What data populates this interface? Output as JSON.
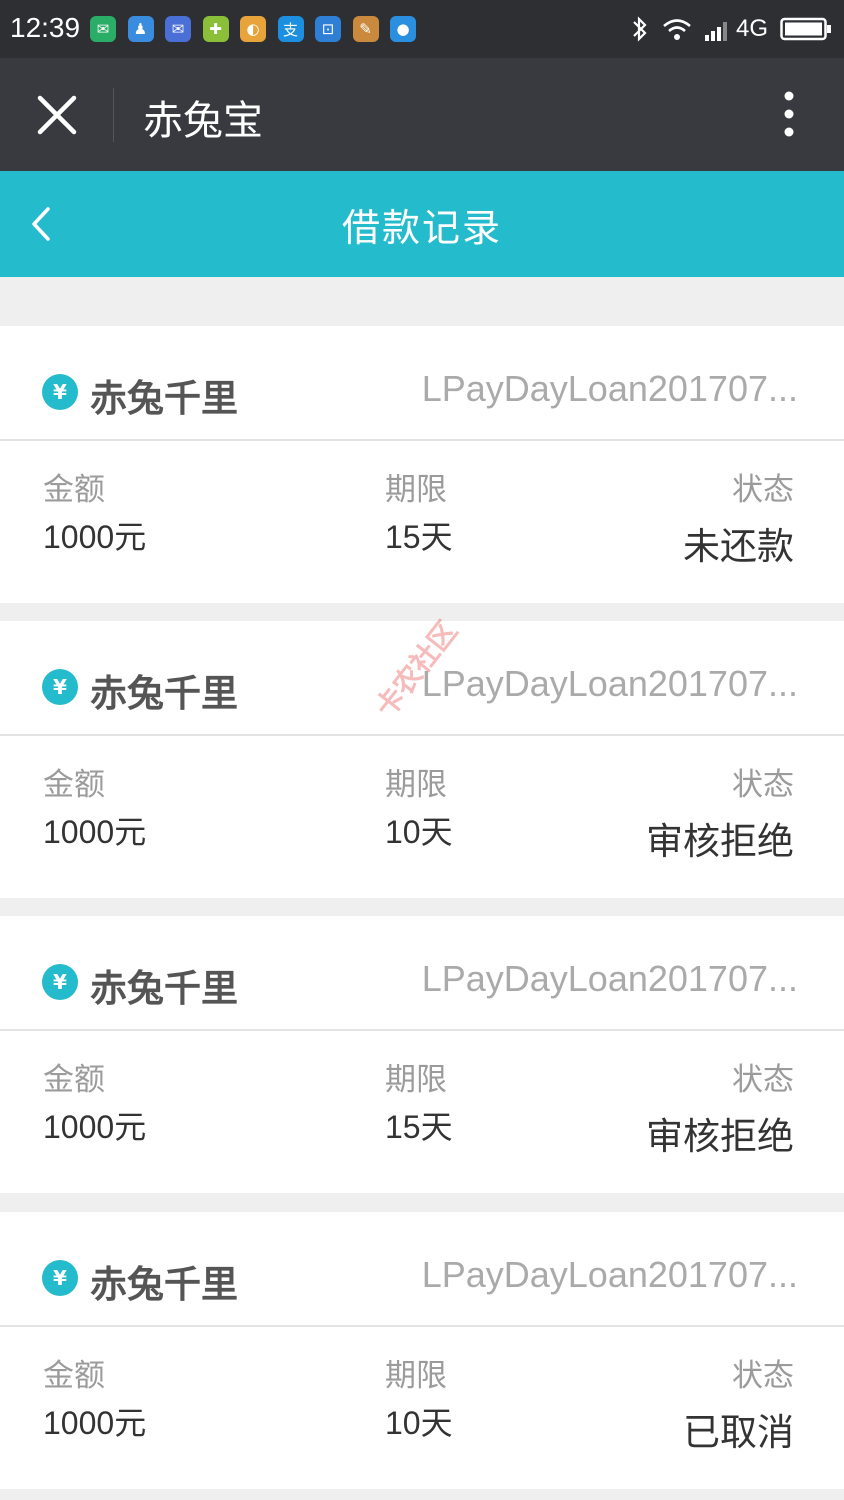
{
  "status_bar": {
    "time": "12:39",
    "network": "4G",
    "notification_icons": [
      {
        "name": "wechat-icon",
        "color": "#2aae67",
        "glyph": "✉"
      },
      {
        "name": "qq-icon",
        "color": "#3a8dde",
        "glyph": "♟"
      },
      {
        "name": "wechat-work-icon",
        "color": "#4a6fd6",
        "glyph": "✉"
      },
      {
        "name": "plus-app-icon",
        "color": "#8bbf3a",
        "glyph": "✚"
      },
      {
        "name": "colorful-app-icon",
        "color": "#e8a43a",
        "glyph": "◐"
      },
      {
        "name": "alipay-icon",
        "color": "#1d8fe1",
        "glyph": "支"
      },
      {
        "name": "scan-icon",
        "color": "#2f7fd6",
        "glyph": "⊡"
      },
      {
        "name": "pen-app-icon",
        "color": "#c98a3e",
        "glyph": "✎"
      },
      {
        "name": "chat-app-icon",
        "color": "#2b8fe0",
        "glyph": "●"
      }
    ]
  },
  "wx_bar": {
    "title": "赤兔宝"
  },
  "header": {
    "title": "借款记录"
  },
  "labels": {
    "amount": "金额",
    "term": "期限",
    "status": "状态"
  },
  "records": [
    {
      "product": "赤兔千里",
      "order_no": "LPayDayLoan201707...",
      "amount": "1000元",
      "term": "15天",
      "status": "未还款"
    },
    {
      "product": "赤兔千里",
      "order_no": "LPayDayLoan201707...",
      "amount": "1000元",
      "term": "10天",
      "status": "审核拒绝"
    },
    {
      "product": "赤兔千里",
      "order_no": "LPayDayLoan201707...",
      "amount": "1000元",
      "term": "15天",
      "status": "审核拒绝"
    },
    {
      "product": "赤兔千里",
      "order_no": "LPayDayLoan201707...",
      "amount": "1000元",
      "term": "10天",
      "status": "已取消"
    }
  ],
  "watermark": "卡农社区",
  "colors": {
    "header": "#24bccc",
    "wx_bar": "#393a3f",
    "status_bar": "#2e2f33"
  }
}
